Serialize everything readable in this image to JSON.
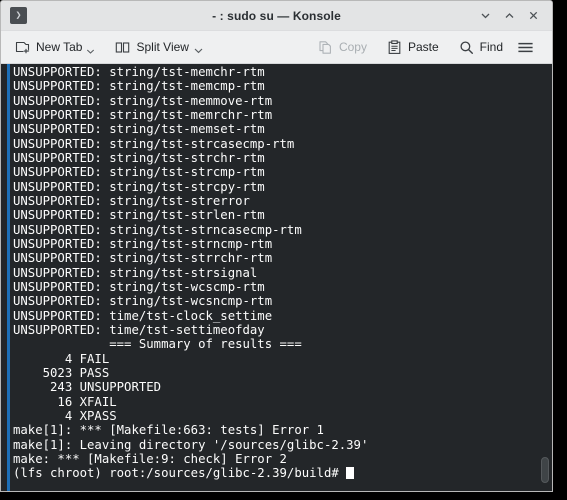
{
  "window": {
    "title": "- : sudo su — Konsole",
    "icon_glyph": "❯",
    "icon_name": "konsole-icon",
    "controls": {
      "minimize": "Minimize",
      "maximize": "Maximize",
      "close": "Close"
    }
  },
  "toolbar": {
    "new_tab_label": "New Tab",
    "split_view_label": "Split View",
    "copy_label": "Copy",
    "paste_label": "Paste",
    "find_label": "Find",
    "menu_label": "Menu"
  },
  "terminal": {
    "background_color": "#232629",
    "foreground_color": "#fcfcfc",
    "focus_stripe_color": "#1d6fb8",
    "lines": [
      "UNSUPPORTED: string/tst-memchr-rtm",
      "UNSUPPORTED: string/tst-memcmp-rtm",
      "UNSUPPORTED: string/tst-memmove-rtm",
      "UNSUPPORTED: string/tst-memrchr-rtm",
      "UNSUPPORTED: string/tst-memset-rtm",
      "UNSUPPORTED: string/tst-strcasecmp-rtm",
      "UNSUPPORTED: string/tst-strchr-rtm",
      "UNSUPPORTED: string/tst-strcmp-rtm",
      "UNSUPPORTED: string/tst-strcpy-rtm",
      "UNSUPPORTED: string/tst-strerror",
      "UNSUPPORTED: string/tst-strlen-rtm",
      "UNSUPPORTED: string/tst-strncasecmp-rtm",
      "UNSUPPORTED: string/tst-strncmp-rtm",
      "UNSUPPORTED: string/tst-strrchr-rtm",
      "UNSUPPORTED: string/tst-strsignal",
      "UNSUPPORTED: string/tst-wcscmp-rtm",
      "UNSUPPORTED: string/tst-wcsncmp-rtm",
      "UNSUPPORTED: time/tst-clock_settime",
      "UNSUPPORTED: time/tst-settimeofday",
      "             === Summary of results ===",
      "       4 FAIL",
      "    5023 PASS",
      "     243 UNSUPPORTED",
      "      16 XFAIL",
      "       4 XPASS",
      "make[1]: *** [Makefile:663: tests] Error 1",
      "make[1]: Leaving directory '/sources/glibc-2.39'",
      "make: *** [Makefile:9: check] Error 2"
    ],
    "prompt": "(lfs chroot) root:/sources/glibc-2.39/build# ",
    "summary": {
      "header": "=== Summary of results ===",
      "fail": 4,
      "pass": 5023,
      "unsupported": 243,
      "xfail": 16,
      "xpass": 4
    },
    "scrollbar_position": "bottom"
  }
}
